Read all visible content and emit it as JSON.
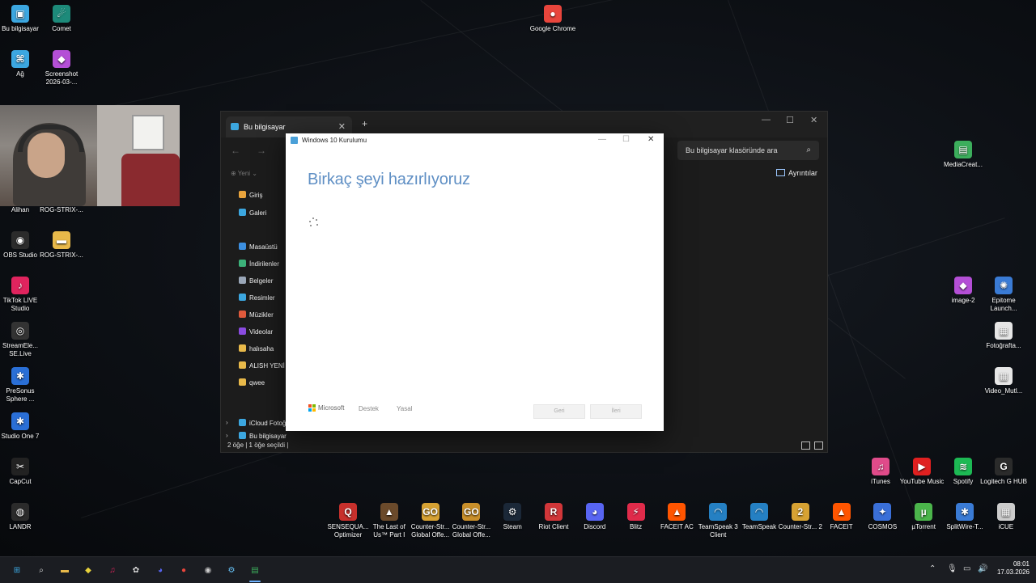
{
  "desktop": {
    "left_icons": [
      {
        "label": "Bu bilgisayar",
        "icon": "computer-icon",
        "color": "#3ca7e0"
      },
      {
        "label": "Comet",
        "icon": "comet-icon",
        "color": "#1d8a7a"
      },
      {
        "label": "Ağ",
        "icon": "network-icon",
        "color": "#3ca7e0"
      },
      {
        "label": "Screenshot 2026-03-...",
        "icon": "screenshot-file-icon",
        "color": "#b44fd6"
      },
      {
        "label": "Alihan",
        "icon": "folder-icon",
        "color": "#e8b94a"
      },
      {
        "label": "ROG-STRIX-...",
        "icon": "folder-icon",
        "color": "#e8b94a"
      },
      {
        "label": "OBS Studio",
        "icon": "obs-icon",
        "color": "#2b2b2b"
      },
      {
        "label": "ROG-STRIX-...",
        "icon": "folder-icon",
        "color": "#e8b94a"
      },
      {
        "label": "TikTok LIVE Studio",
        "icon": "tiktok-icon",
        "color": "#e0245e"
      },
      {
        "label": "StreamEle... SE.Live",
        "icon": "streamelements-icon",
        "color": "#333333"
      },
      {
        "label": "PreSonus Sphere ...",
        "icon": "presonus-icon",
        "color": "#2a6fd6"
      },
      {
        "label": "Studio One 7",
        "icon": "studio-one-icon",
        "color": "#2a6fd6"
      },
      {
        "label": "CapCut",
        "icon": "capcut-icon",
        "color": "#222222"
      },
      {
        "label": "LANDR",
        "icon": "landr-icon",
        "color": "#2b2b2b"
      }
    ],
    "top_icons": [
      {
        "label": "Google Chrome",
        "icon": "chrome-icon",
        "color": "#e8453c"
      }
    ],
    "right_icons": [
      {
        "label": "MediaCreat...",
        "icon": "media-creation-icon",
        "color": "#3cae5c"
      },
      {
        "label": "image-2",
        "icon": "image-icon",
        "color": "#b44fd6"
      },
      {
        "label": "Epitome Launch...",
        "icon": "epitome-icon",
        "color": "#3a7bd5"
      },
      {
        "label": "Fotoğrafta...",
        "icon": "file-icon",
        "color": "#e6e6e6"
      },
      {
        "label": "Video_Mutl...",
        "icon": "file-icon",
        "color": "#e6e6e6"
      },
      {
        "label": "iTunes",
        "icon": "itunes-icon",
        "color": "#e04b8a"
      },
      {
        "label": "YouTube Music",
        "icon": "youtube-music-icon",
        "color": "#e02020"
      },
      {
        "label": "Spotify",
        "icon": "spotify-icon",
        "color": "#1db954"
      },
      {
        "label": "Logitech G HUB",
        "icon": "logitech-icon",
        "color": "#2b2b2b"
      }
    ],
    "bottom_icons": [
      {
        "label": "SENSEQUA... Optimizer",
        "icon": "sensequality-icon",
        "color": "#c8302c"
      },
      {
        "label": "The Last of Us™ Part I",
        "icon": "tlou-icon",
        "color": "#6b4a2b"
      },
      {
        "label": "Counter-Str... Global Offe...",
        "icon": "csgo-icon",
        "color": "#d7a233"
      },
      {
        "label": "Counter-Str... Global Offe...",
        "icon": "csgo-icon",
        "color": "#c98f2a"
      },
      {
        "label": "Steam",
        "icon": "steam-icon",
        "color": "#1b2838"
      },
      {
        "label": "Riot Client",
        "icon": "riot-icon",
        "color": "#d13639"
      },
      {
        "label": "Discord",
        "icon": "discord-icon",
        "color": "#5865f2"
      },
      {
        "label": "Blitz",
        "icon": "blitz-icon",
        "color": "#e02b4a"
      },
      {
        "label": "FACEIT AC",
        "icon": "faceit-ac-icon",
        "color": "#ff5500"
      },
      {
        "label": "TeamSpeak 3 Client",
        "icon": "teamspeak-icon",
        "color": "#2580c3"
      },
      {
        "label": "TeamSpeak",
        "icon": "teamspeak-icon",
        "color": "#2580c3"
      },
      {
        "label": "Counter-Str... 2",
        "icon": "cs2-icon",
        "color": "#d7a233"
      },
      {
        "label": "FACEIT",
        "icon": "faceit-icon",
        "color": "#ff5500"
      },
      {
        "label": "COSMOS",
        "icon": "cosmos-icon",
        "color": "#3a6fd8"
      },
      {
        "label": "µTorrent",
        "icon": "utorrent-icon",
        "color": "#4bb54b"
      },
      {
        "label": "SplitWire-T...",
        "icon": "splitwire-icon",
        "color": "#3a7bd5"
      },
      {
        "label": "iCUE",
        "icon": "icue-icon",
        "color": "#cccccc"
      }
    ]
  },
  "explorer": {
    "tab_title": "Bu bilgisayar",
    "tab_close": "✕",
    "new_tab": "+",
    "search_placeholder": "Bu bilgisayar klasöründe ara",
    "new_button": "Yeni",
    "details_label": "Ayrıntılar",
    "sidebar": [
      {
        "label": "Giriş",
        "icon": "home-icon",
        "color": "#e8a33c"
      },
      {
        "label": "Galeri",
        "icon": "gallery-icon",
        "color": "#3ca7e0"
      },
      {
        "label": "Masaüstü",
        "icon": "desktop-folder-icon",
        "color": "#3c8fe0"
      },
      {
        "label": "İndirilenler",
        "icon": "downloads-icon",
        "color": "#3cb27a"
      },
      {
        "label": "Belgeler",
        "icon": "documents-icon",
        "color": "#9aa7b8"
      },
      {
        "label": "Resimler",
        "icon": "pictures-icon",
        "color": "#3ca7e0"
      },
      {
        "label": "Müzikler",
        "icon": "music-icon",
        "color": "#e05a3c"
      },
      {
        "label": "Videolar",
        "icon": "videos-icon",
        "color": "#8a4be0"
      },
      {
        "label": "halısaha",
        "icon": "folder-icon",
        "color": "#e8b94a"
      },
      {
        "label": "ALISH YENİ C",
        "icon": "folder-icon",
        "color": "#e8b94a"
      },
      {
        "label": "qwee",
        "icon": "folder-icon",
        "color": "#e8b94a"
      },
      {
        "label": "iCloud Fotoğ",
        "icon": "icloud-icon",
        "color": "#3ca7e0"
      },
      {
        "label": "Bu bilgisayar",
        "icon": "computer-icon",
        "color": "#3ca7e0"
      }
    ],
    "status": "2 öğe  |  1 öğe seçildi  |"
  },
  "setup": {
    "window_title": "Windows 10 Kurulumu",
    "heading": "Birkaç şeyi hazırlıyoruz",
    "footer": {
      "microsoft": "Microsoft",
      "support": "Destek",
      "legal": "Yasal",
      "back": "Geri",
      "next": "İleri"
    }
  },
  "taskbar": {
    "apps": [
      {
        "icon": "windows-start-icon",
        "color": "#3ca7e0"
      },
      {
        "icon": "search-icon",
        "color": "#dddddd"
      },
      {
        "icon": "file-explorer-icon",
        "color": "#e8b94a"
      },
      {
        "icon": "vpn-icon",
        "color": "#e8d23c"
      },
      {
        "icon": "music-app-icon",
        "color": "#e0245e"
      },
      {
        "icon": "chatgpt-icon",
        "color": "#dddddd"
      },
      {
        "icon": "discord-icon",
        "color": "#5865f2"
      },
      {
        "icon": "chrome-icon",
        "color": "#e8453c"
      },
      {
        "icon": "obs-icon",
        "color": "#cccccc"
      },
      {
        "icon": "steam-icon",
        "color": "#66c0f4"
      },
      {
        "icon": "setup-icon",
        "color": "#3cae5c"
      }
    ],
    "time": "08:01",
    "date": "17.03.2026"
  }
}
